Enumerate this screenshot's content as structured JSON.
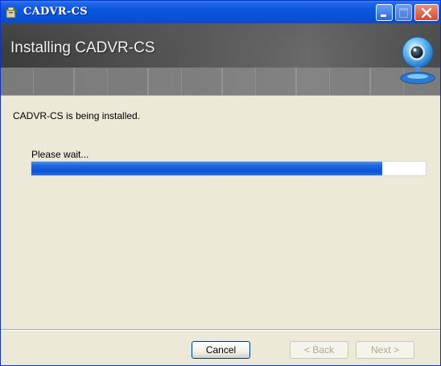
{
  "window": {
    "title": "CADVR-CS",
    "icon": "installer-package-icon",
    "controls": [
      "minimize-icon",
      "maximize-icon",
      "close-icon"
    ]
  },
  "banner": {
    "title": "Installing CADVR-CS",
    "logo": "webcam-logo-icon"
  },
  "body": {
    "status_text": "CADVR-CS is being installed.",
    "wait_label": "Please wait...",
    "progress_fraction": 0.89
  },
  "buttons": {
    "cancel_label": "Cancel",
    "back_label": "< Back",
    "next_label": "Next >",
    "back_enabled": false,
    "next_enabled": false
  },
  "colors": {
    "titlebar": "#0a56e0",
    "progress_fill": "#0a55d4",
    "dialog_bg": "#ece9d8"
  }
}
